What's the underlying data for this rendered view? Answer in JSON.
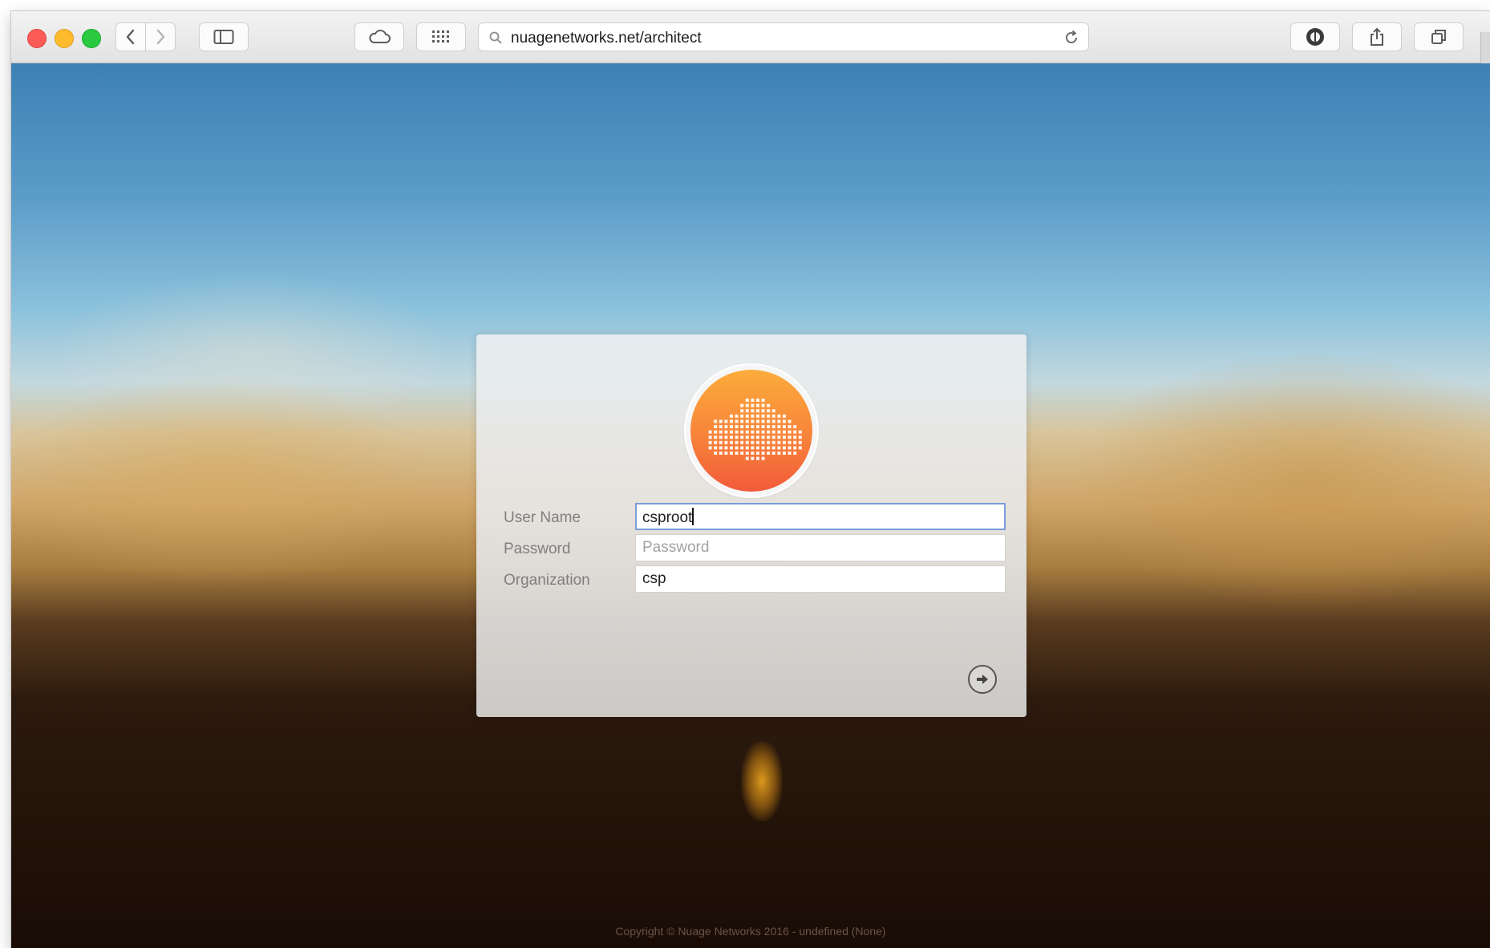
{
  "browser": {
    "url": "nuagenetworks.net/architect",
    "toolbar_icons": [
      "back-icon",
      "forward-icon",
      "sidebar-icon",
      "icloud-icon",
      "top-sites-icon",
      "search-icon",
      "reload-icon",
      "privacy-icon",
      "share-icon",
      "tabs-overview-icon"
    ]
  },
  "login": {
    "logo_icon": "nuage-cloud-logo",
    "username_label": "User Name",
    "username_value": "csproot",
    "password_label": "Password",
    "password_placeholder": "Password",
    "organization_label": "Organization",
    "organization_value": "csp",
    "submit_icon": "arrow-right-circle-icon"
  },
  "footer": {
    "copyright": "Copyright © Nuage Networks 2016 - undefined (None)"
  },
  "colors": {
    "logo_top": "#fcac3b",
    "logo_bottom": "#f25a3a",
    "focus_border": "#7a9cd9"
  }
}
